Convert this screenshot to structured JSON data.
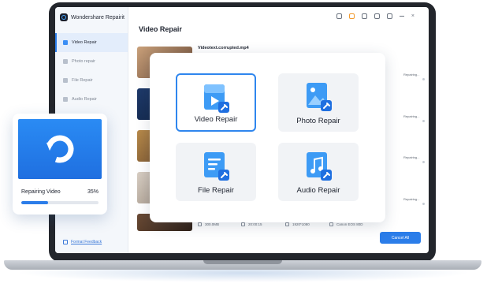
{
  "app": {
    "title": "Wondershare Repairit"
  },
  "sidebar": {
    "items": [
      {
        "label": "Video Repair",
        "active": true
      },
      {
        "label": "Photo repair",
        "active": false
      },
      {
        "label": "File Repair",
        "active": false
      },
      {
        "label": "Audio Repair",
        "active": false
      }
    ],
    "feedback_label": "Format Feedback"
  },
  "topbar": {
    "icons": [
      "user-icon",
      "cart-icon",
      "headset-icon",
      "mail-icon",
      "menu-icon"
    ]
  },
  "main": {
    "title": "Video Repair",
    "file_name": "Videotext.corrupted.mp4",
    "row_status": [
      "Repairing...",
      "Repairing...",
      "Repairing...",
      "Repairing..."
    ],
    "meta": {
      "size": "300.0MB",
      "duration": "20:00:15",
      "resolution": "1920*1080",
      "camera": "Canon EOS 80D"
    },
    "cancel_label": "Cancel All"
  },
  "popup": {
    "cards": [
      {
        "label": "Video Repair",
        "icon": "video-file-icon",
        "selected": true
      },
      {
        "label": "Photo Repair",
        "icon": "photo-file-icon",
        "selected": false
      },
      {
        "label": "File Repair",
        "icon": "document-file-icon",
        "selected": false
      },
      {
        "label": "Audio Repair",
        "icon": "audio-file-icon",
        "selected": false
      }
    ]
  },
  "progress": {
    "label": "Repairing Video",
    "percent_text": "35%",
    "percent": 35
  },
  "colors": {
    "accent": "#2b7de9",
    "accent_light": "#4aa8ff",
    "bezel": "#23262c"
  }
}
